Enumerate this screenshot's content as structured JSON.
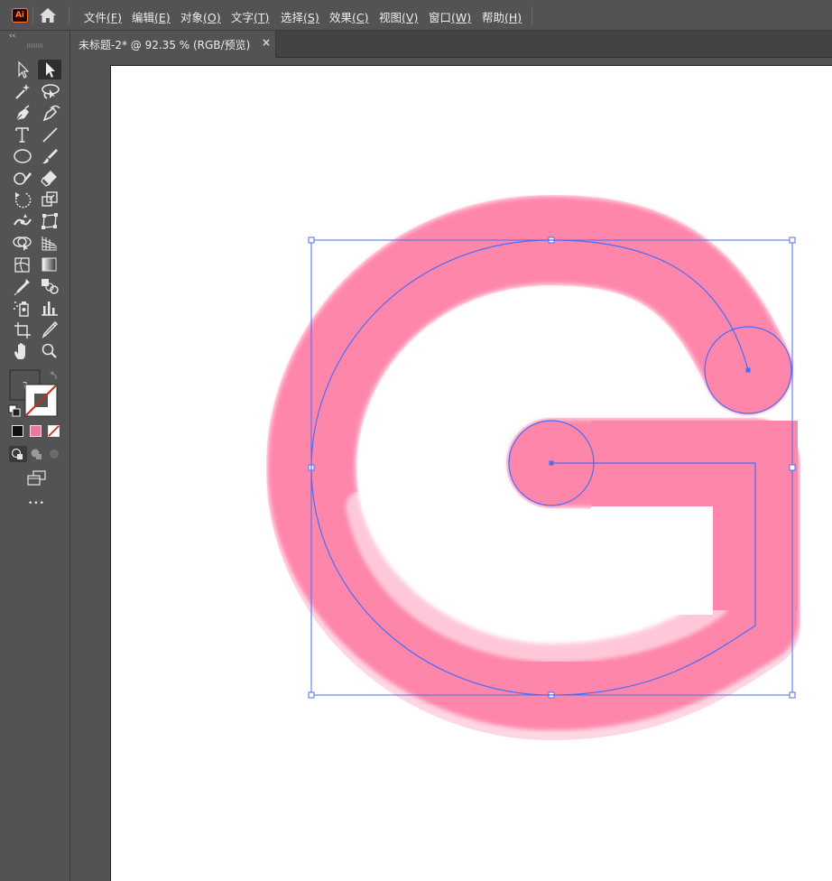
{
  "app": {
    "logo_text": "Ai"
  },
  "menu": [
    {
      "label": "文件",
      "accel": "(F)"
    },
    {
      "label": "编辑",
      "accel": "(E)"
    },
    {
      "label": "对象",
      "accel": "(O)"
    },
    {
      "label": "文字",
      "accel": "(T)"
    },
    {
      "label": "选择",
      "accel": "(S)"
    },
    {
      "label": "效果",
      "accel": "(C)"
    },
    {
      "label": "视图",
      "accel": "(V)"
    },
    {
      "label": "窗口",
      "accel": "(W)"
    },
    {
      "label": "帮助",
      "accel": "(H)"
    }
  ],
  "document": {
    "tab_title": "未标题-2* @ 92.35 % (RGB/预览)",
    "close_glyph": "×"
  },
  "toolbar": {
    "collapse_glyph": "‹‹",
    "more_glyph": "•••",
    "tools": [
      "selection-tool",
      "direct-selection-tool",
      "magic-wand-tool",
      "lasso-tool",
      "pen-tool",
      "curvature-tool",
      "type-tool",
      "line-segment-tool",
      "ellipse-tool",
      "paintbrush-tool",
      "shaper-tool",
      "eraser-tool",
      "rotate-tool",
      "scale-tool",
      "puppet-warp-tool",
      "free-transform-tool",
      "shape-builder-tool",
      "perspective-grid-tool",
      "mesh-tool",
      "gradient-tool",
      "eyedropper-tool",
      "blend-tool",
      "symbol-sprayer-tool",
      "column-graph-tool",
      "artboard-tool",
      "slice-tool",
      "hand-tool",
      "zoom-tool"
    ]
  },
  "colors": {
    "shape_fill": "#ff86ab",
    "selection": "#4a6cf7",
    "fill_swatch": "#e87aa0"
  }
}
